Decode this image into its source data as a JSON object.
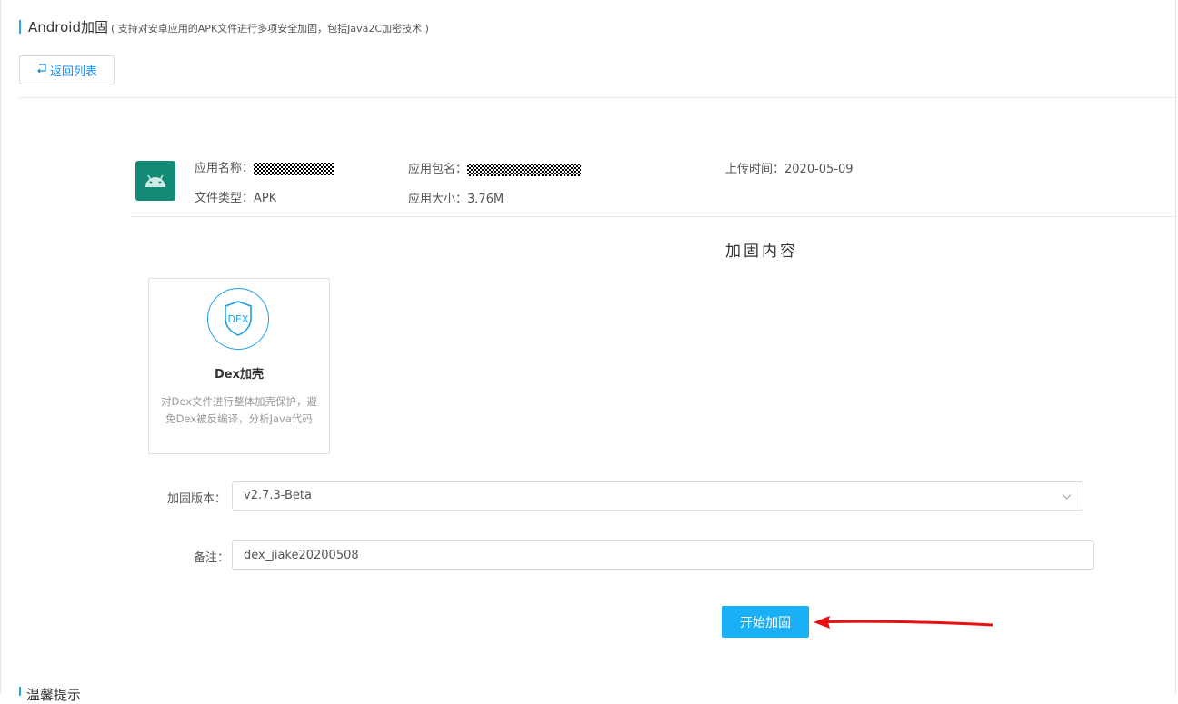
{
  "header": {
    "title": "Android加固",
    "subtitle": "( 支持对安卓应用的APK文件进行多项安全加固，包括Java2C加密技术 )",
    "back_icon": "return-arrow-icon",
    "back_label": "返回列表"
  },
  "app": {
    "icon": "android-icon",
    "name_label": "应用名称：",
    "package_label": "应用包名：",
    "upload_label": "上传时间：",
    "upload_value": "2020-05-09",
    "filetype_label": "文件类型：",
    "filetype_value": "APK",
    "size_label": "应用大小：",
    "size_value": "3.76M"
  },
  "section_title": "加固内容",
  "card": {
    "icon": "dex-shield-icon",
    "icon_text": "DEX",
    "title": "Dex加壳",
    "desc": "对Dex文件进行整体加壳保护，避免Dex被反编译，分析Java代码"
  },
  "form": {
    "version_label": "加固版本：",
    "version_value": "v2.7.3-Beta",
    "remark_label": "备注：",
    "remark_value": "dex_jiake20200508"
  },
  "start_label": "开始加固",
  "tip_title": "温馨提示",
  "colors": {
    "accent": "#1ab0f5",
    "android_green": "#138a76",
    "arrow": "#e81010"
  }
}
